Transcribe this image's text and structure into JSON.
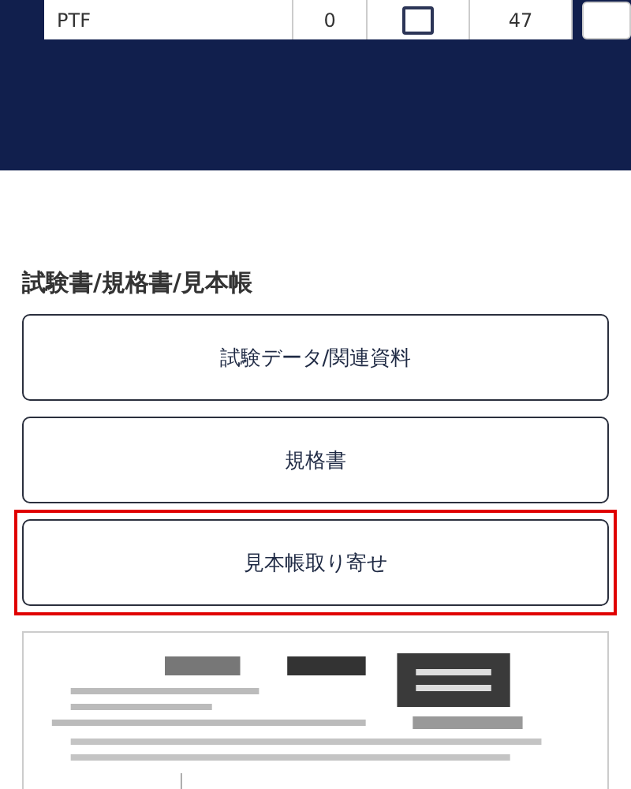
{
  "table_row": {
    "cells": [
      "PTF",
      "0",
      "47"
    ],
    "checked": false
  },
  "section": {
    "title": "試験書/規格書/見本帳"
  },
  "buttons": [
    {
      "label": "試験データ/関連資料",
      "highlighted": false
    },
    {
      "label": "規格書",
      "highlighted": false
    },
    {
      "label": "見本帳取り寄せ",
      "highlighted": true
    }
  ]
}
